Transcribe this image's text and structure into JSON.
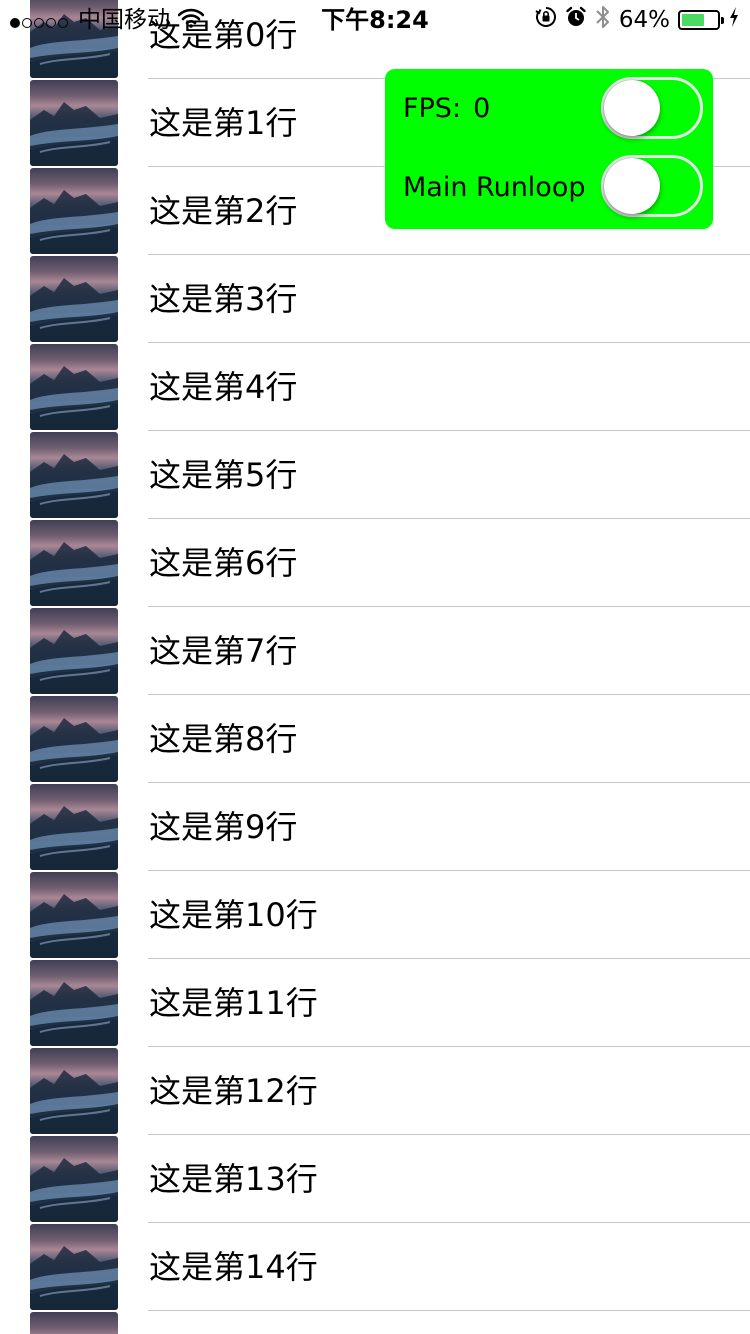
{
  "status_bar": {
    "carrier": "中国移动",
    "time": "下午8:24",
    "battery_percent": "64%",
    "battery_level": 0.64,
    "signal_bars_filled": 1,
    "signal_bars_total": 5,
    "icons": [
      "wifi-icon",
      "orientation-lock-icon",
      "alarm-icon",
      "bluetooth-icon",
      "battery-icon",
      "charging-icon"
    ]
  },
  "monitor": {
    "background_color": "#00ff00",
    "fps_label": "FPS:",
    "fps_value": "0",
    "runloop_label": "Main Runloop",
    "fps_toggle_on": false,
    "runloop_toggle_on": false
  },
  "table": {
    "rows": [
      {
        "label": "这是第0行"
      },
      {
        "label": "这是第1行"
      },
      {
        "label": "这是第2行"
      },
      {
        "label": "这是第3行"
      },
      {
        "label": "这是第4行"
      },
      {
        "label": "这是第5行"
      },
      {
        "label": "这是第6行"
      },
      {
        "label": "这是第7行"
      },
      {
        "label": "这是第8行"
      },
      {
        "label": "这是第9行"
      },
      {
        "label": "这是第10行"
      },
      {
        "label": "这是第11行"
      },
      {
        "label": "这是第12行"
      },
      {
        "label": "这是第13行"
      },
      {
        "label": "这是第14行"
      },
      {
        "label": ""
      }
    ],
    "separator_color": "#c8c7cc"
  }
}
